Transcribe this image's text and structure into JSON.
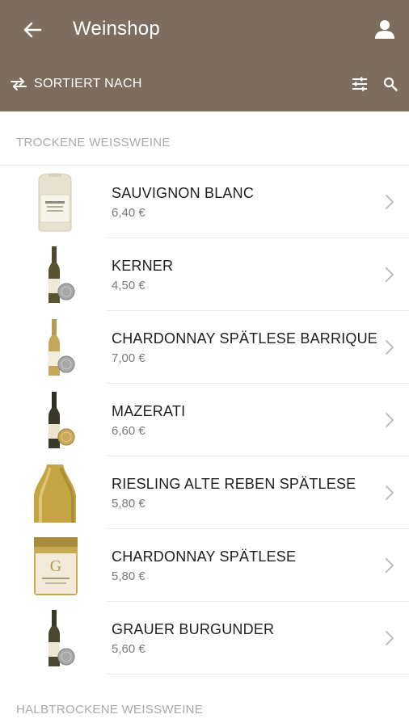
{
  "header": {
    "title": "Weinshop"
  },
  "toolbar": {
    "sort_label": "SORTIERT NACH"
  },
  "sections": [
    {
      "title": "TROCKENE WEISSWEINE"
    },
    {
      "title": "HALBTROCKENE WEISSWEINE"
    }
  ],
  "products": [
    {
      "name": "SAUVIGNON BLANC",
      "price": "6,40 €"
    },
    {
      "name": "KERNER",
      "price": "4,50 €"
    },
    {
      "name": "CHARDONNAY SPÄTLESE BARRIQUE",
      "price": "7,00 €"
    },
    {
      "name": "MAZERATI",
      "price": "6,60 €"
    },
    {
      "name": "RIESLING ALTE REBEN SPÄTLESE",
      "price": "5,80 €"
    },
    {
      "name": "CHARDONNAY SPÄTLESE",
      "price": "5,80 €"
    },
    {
      "name": "GRAUER BURGUNDER",
      "price": "5,60 €"
    }
  ],
  "colors": {
    "appbar": "#7c6d5f",
    "section_text": "#a9a9a9",
    "medal_silver": "#a8a8a8",
    "medal_gold": "#c9a95a"
  },
  "icons": [
    "arrow-back-icon",
    "user-icon",
    "swap-icon",
    "tune-icon",
    "search-icon",
    "chevron-right-icon",
    "wine-bottle-icon",
    "medal-icon"
  ]
}
